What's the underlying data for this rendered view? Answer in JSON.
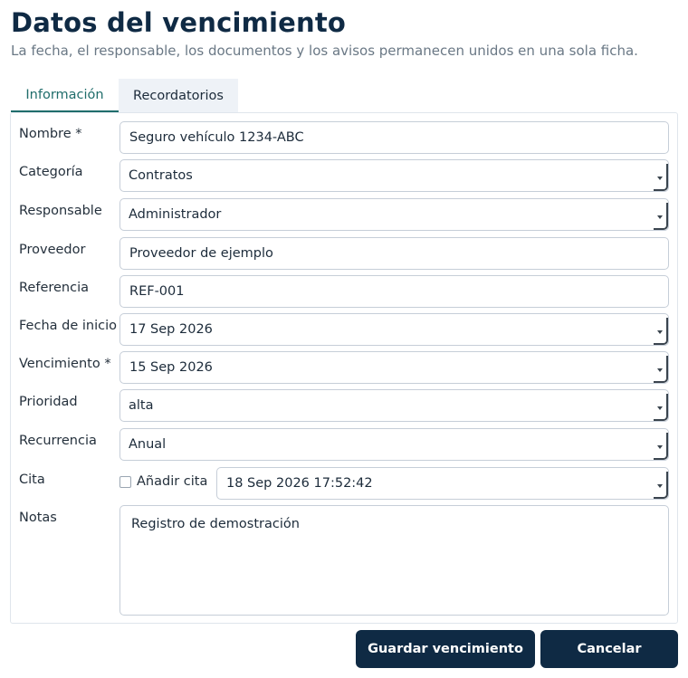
{
  "header": {
    "title": "Datos del vencimiento",
    "subtitle": "La fecha, el responsable, los documentos y los avisos permanecen unidos en una sola ficha."
  },
  "tabs": [
    {
      "label": "Información",
      "active": true
    },
    {
      "label": "Recordatorios",
      "active": false
    }
  ],
  "form": {
    "nombre": {
      "label": "Nombre *",
      "value": "Seguro vehículo 1234-ABC"
    },
    "categoria": {
      "label": "Categoría",
      "value": "Contratos"
    },
    "responsable": {
      "label": "Responsable",
      "value": "Administrador"
    },
    "proveedor": {
      "label": "Proveedor",
      "value": "Proveedor de ejemplo"
    },
    "referencia": {
      "label": "Referencia",
      "value": "REF-001"
    },
    "fecha_inicio": {
      "label": "Fecha de inicio",
      "value": "17 Sep 2026"
    },
    "vencimiento": {
      "label": "Vencimiento *",
      "value": "15 Sep 2026"
    },
    "prioridad": {
      "label": "Prioridad",
      "value": "alta"
    },
    "recurrencia": {
      "label": "Recurrencia",
      "value": "Anual"
    },
    "cita": {
      "label": "Cita",
      "checkbox_label": "Añadir cita",
      "checked": false,
      "value": "18 Sep 2026 17:52:42"
    },
    "notas": {
      "label": "Notas",
      "value": "Registro de demostración"
    }
  },
  "actions": {
    "save_label": "Guardar vencimiento",
    "cancel_label": "Cancelar"
  },
  "colors": {
    "accent": "#1f6d6b",
    "primary": "#0f2a44",
    "tab_inactive_bg": "#eef2f7"
  }
}
